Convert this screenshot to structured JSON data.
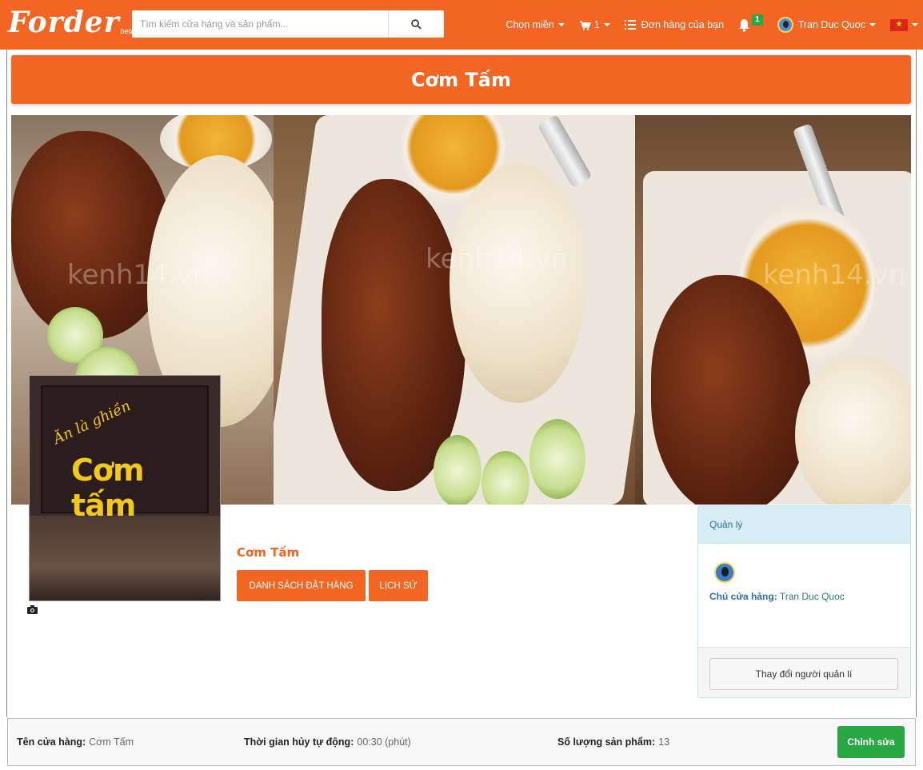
{
  "navbar": {
    "logo_text": "Forder",
    "logo_sub": "beta",
    "search_placeholder": "Tìm kiếm cửa hàng và sản phẩm...",
    "region_label": "Chọn miền",
    "cart_count": "1",
    "orders_label": "Đơn hàng của bạn",
    "notification_count": "1",
    "user_name": "Tran Duc Quoc",
    "accent_color": "#f26522"
  },
  "page": {
    "title": "Cơm Tấm"
  },
  "banner": {
    "watermark": "kenh14.vn",
    "logo_sign_script": "Ăn là ghiền",
    "logo_sign_main": "Cơm tấm"
  },
  "store": {
    "name": "Cơm Tấm",
    "orders_button": "DANH SÁCH ĐẶT HÀNG",
    "history_button": "LỊCH SỬ"
  },
  "manager": {
    "heading": "Quản lý",
    "owner_label": "Chủ cửa hàng:",
    "owner_name": "Tran Duc Quoc",
    "change_button": "Thay đổi người quản lí"
  },
  "info": {
    "store_name_label": "Tên cửa hàng:",
    "store_name_value": "Cơm Tấm",
    "cancel_time_label": "Thời gian hủy tự động:",
    "cancel_time_value": "00:30 (phút)",
    "product_count_label": "Số lượng sản phẩm:",
    "product_count_value": "13",
    "edit_button": "Chỉnh sửa",
    "edit_color": "#28a745"
  }
}
